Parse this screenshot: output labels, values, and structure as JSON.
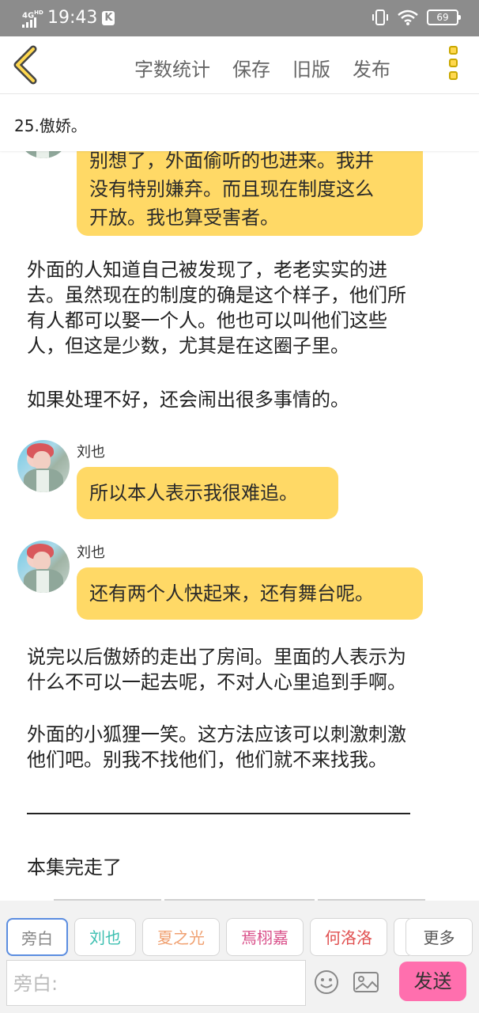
{
  "status_bar": {
    "network": "4G",
    "network_sup": "HD",
    "time": "19:43",
    "k_badge": "K",
    "battery": "69",
    "icons": [
      "vibrate-icon",
      "wifi-icon",
      "battery-icon"
    ]
  },
  "toolbar": {
    "back_icon": "chevron-left-icon",
    "actions": [
      "字数统计",
      "保存",
      "旧版",
      "发布"
    ],
    "more_icon": "more-vertical-icon"
  },
  "chapter": {
    "title": "25.傲娇。"
  },
  "messages": {
    "m0": {
      "lines": [
        "别想了，外面偷听的也进来。我并",
        "没有特别嫌弃。而且现在制度这么",
        "开放。我也算受害者。"
      ]
    },
    "p1": {
      "lines": [
        "外面的人知道自己被发现了，老老实实的进",
        "去。虽然现在的制度的确是这个样子，他们所",
        "有人都可以娶一个人。他也可以叫他们这些",
        "人，但这是少数，尤其是在这圈子里。"
      ]
    },
    "p2": {
      "text": "如果处理不好，还会闹出很多事情的。"
    },
    "m1": {
      "name": "刘也",
      "text": "所以本人表示我很难追。"
    },
    "m2": {
      "name": "刘也",
      "text": "还有两个人快起来，还有舞台呢。"
    },
    "p3": {
      "lines": [
        "说完以后傲娇的走出了房间。里面的人表示为",
        "什么不可以一起去呢，不对人心里追到手啊。"
      ]
    },
    "p4": {
      "lines": [
        "外面的小狐狸一笑。这方法应该可以刺激刺激",
        "他们吧。别我不找他们，他们就不来找我。"
      ]
    },
    "p5": {
      "text": "本集完走了"
    }
  },
  "roles": [
    {
      "label": "旁白",
      "color": "#888888",
      "active": true
    },
    {
      "label": "刘也",
      "color": "#3bbfb0"
    },
    {
      "label": "夏之光",
      "color": "#f0a070"
    },
    {
      "label": "焉栩嘉",
      "color": "#d9508a"
    },
    {
      "label": "何洛洛",
      "color": "#e05050"
    },
    {
      "label": "更多",
      "color": "#555555"
    }
  ],
  "input": {
    "placeholder": "旁白:"
  },
  "send_label": "发送",
  "colors": {
    "bubble": "#ffd966",
    "send": "#ff6fae",
    "status_bar": "#8c8c8c",
    "more_icon": "#ffd84f"
  }
}
